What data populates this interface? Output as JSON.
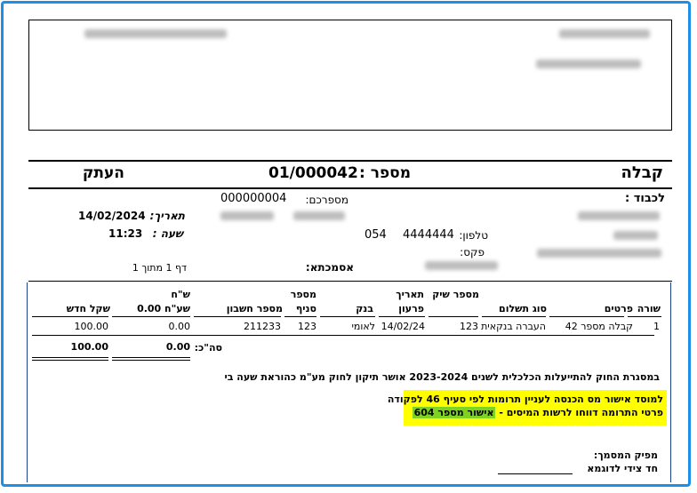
{
  "doc": {
    "title": "קבלה",
    "number_label": "מספר :",
    "number_value": "01/000042",
    "copy_label": "העתק",
    "to_label": "לכבוד :",
    "dealer_label": "מספרכם:",
    "dealer_value": "000000004",
    "phone_label": "טלפון:",
    "phone_number": "4444444",
    "phone_prefix": "054",
    "fax_label": "פקס:",
    "date_label": "תאריך:",
    "date_value": "14/02/2024",
    "time_label": "שעה :",
    "time_value": "11:23",
    "page_label": "דף 1 מתוך 1",
    "reference_label": "אסמכתא:"
  },
  "table": {
    "headers": {
      "line": "שורה",
      "details": "פרטים",
      "payment_type": "סוג תשלום",
      "check_number": "מספר שיק",
      "due_date_1": "תאריך",
      "due_date_2": "פרעון",
      "bank": "בנק",
      "branch_1": "מספר",
      "branch_2": "סניף",
      "account": "מספר חשבון",
      "usd_1": "ש\"ח",
      "usd_2": "שע\"ח 0.00",
      "nis": "שקל חדש"
    },
    "row": {
      "line": "1",
      "details": "קבלה מספר 42",
      "payment_type": "העברה בנקאית",
      "check_number": "123",
      "due_date": "14/02/24",
      "bank": "לאומי",
      "branch": "123",
      "account": "211233",
      "usd": "0.00",
      "nis": "100.00"
    },
    "total_label": "סה\"כ:",
    "total_usd": "0.00",
    "total_nis": "100.00"
  },
  "notes": {
    "law_text": "במסגרת החוק להתייעלות הכלכלית לשנים 2023-2024 אושר תיקון לחוק מע\"מ כהוראת שעה בי",
    "tax_line1": "למוסד אישור מס הכנסה לעניין תרומות לפי סעיף 46 לפקודה",
    "tax_line2": "פרטי התרומה דווחו לרשות המיסים -",
    "tax_approval": "אישור מספר 604",
    "issuer_label": "מפיק המסמך:",
    "issuer_name": "חד צידי לדוגמא"
  },
  "colors": {
    "frame": "#1e8fe6",
    "note_bg": "#ffff00",
    "approval_bg": "#7ed321"
  }
}
